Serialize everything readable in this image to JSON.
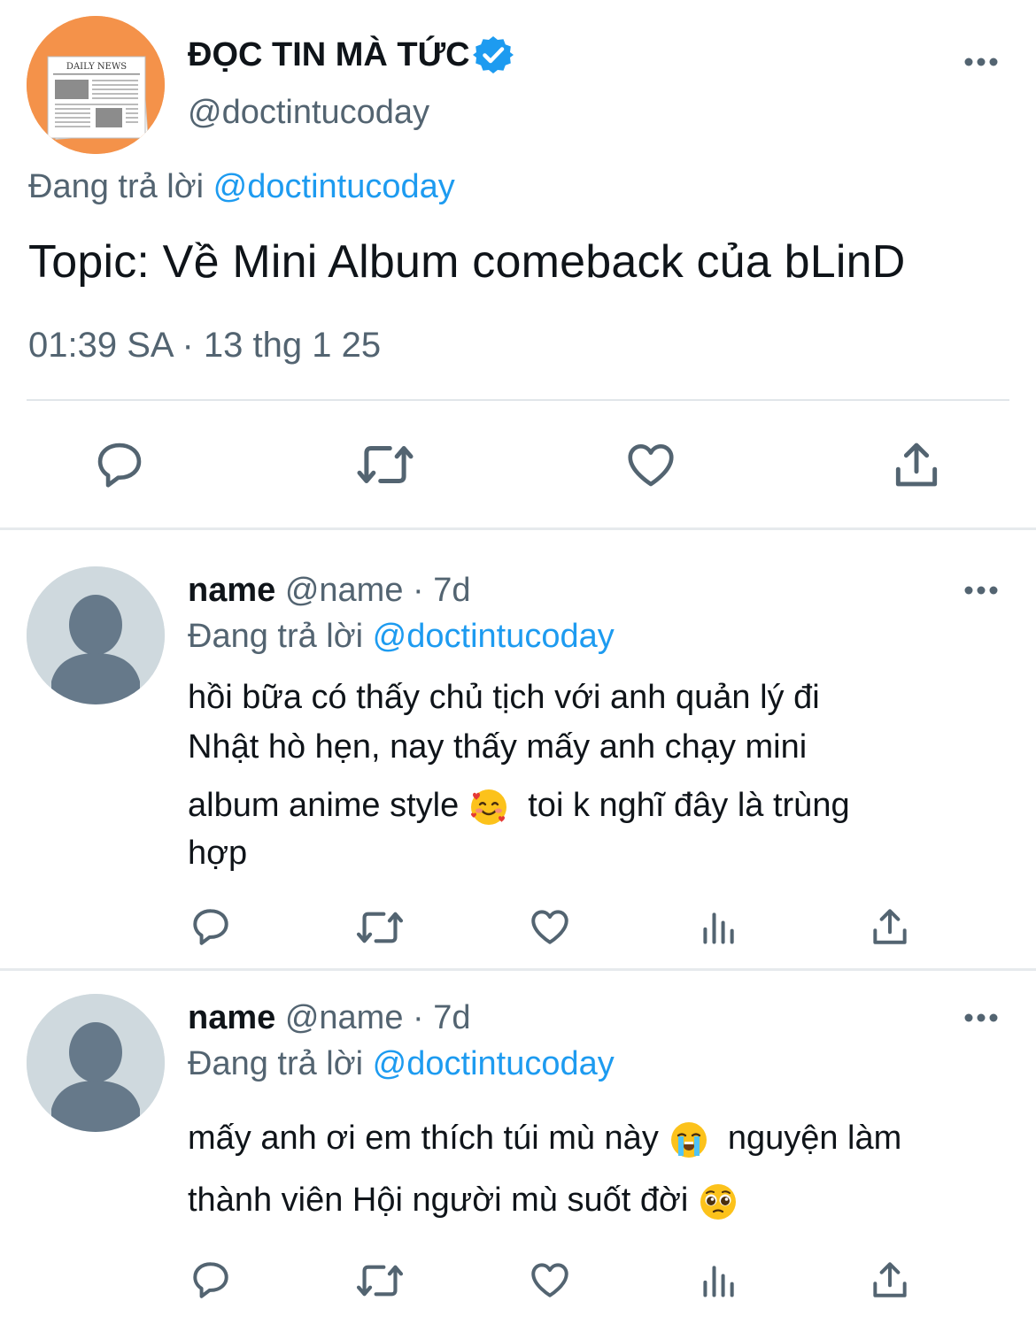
{
  "main_tweet": {
    "avatar_label": "DAILY NEWS",
    "display_name": "ĐỌC TIN MÀ TỨC",
    "handle": "@doctintucoday",
    "replying_prefix": "Đang trả lời",
    "replying_to": "@doctintucoday",
    "text": "Topic: Về Mini Album comeback của bLinD",
    "timestamp": "01:39 SA · 13 thg 1 25",
    "actions": [
      "reply-icon",
      "retweet-icon",
      "like-icon",
      "share-icon"
    ]
  },
  "replies": [
    {
      "name": "name",
      "handle_time": "@name · 7d",
      "replying_prefix": "Đang trả lời",
      "replying_to": "@doctintucoday",
      "lines": [
        "hồi bữa có thấy chủ tịch với anh quản lý đi",
        "Nhật hò hẹn, nay thấy mấy anh chạy mini",
        "album anime style",
        "toi k nghĩ đây là trùng",
        "hợp"
      ],
      "emojis": [
        "smiling-face-with-hearts-emoji"
      ],
      "actions": [
        "reply-icon",
        "retweet-icon",
        "like-icon",
        "views-icon",
        "share-icon"
      ]
    },
    {
      "name": "name",
      "handle_time": "@name · 7d",
      "replying_prefix": "Đang trả lời",
      "replying_to": "@doctintucoday",
      "lines": [
        "mấy anh ơi em thích túi mù này",
        "nguyện làm",
        "thành viên Hội người mù suốt đời"
      ],
      "emojis": [
        "loudly-crying-face-emoji",
        "pleading-face-emoji"
      ],
      "actions": [
        "reply-icon",
        "retweet-icon",
        "like-icon",
        "views-icon",
        "share-icon"
      ]
    }
  ],
  "colors": {
    "text": "#0f1419",
    "secondary": "#536471",
    "link": "#1d9bf0",
    "divider": "#e1e6ea",
    "avatar_orange": "#f4924a",
    "avatar_default": "#cfd9de"
  }
}
